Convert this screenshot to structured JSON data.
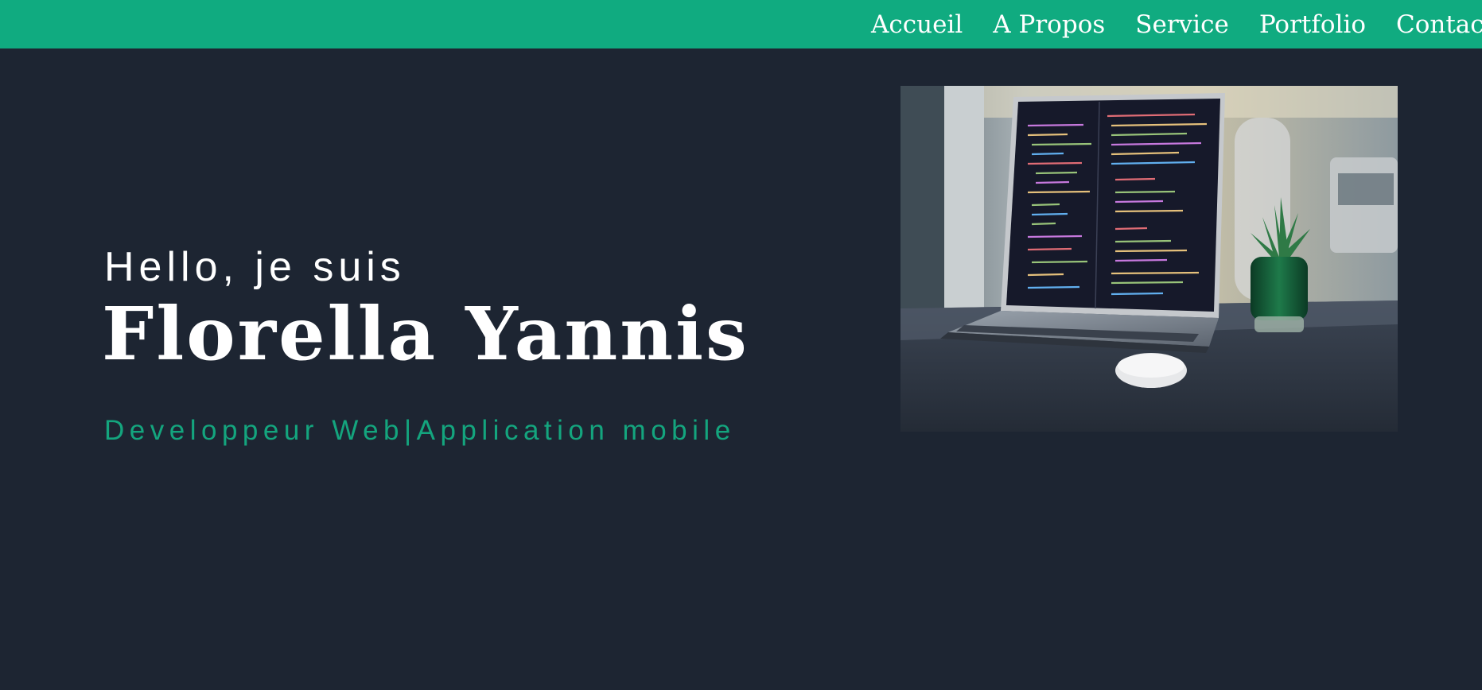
{
  "nav": {
    "items": [
      {
        "label": "Accueil"
      },
      {
        "label": "A Propos"
      },
      {
        "label": "Service"
      },
      {
        "label": "Portfolio"
      },
      {
        "label": "Contact"
      }
    ]
  },
  "hero": {
    "greeting": "Hello, je suis",
    "name": "Florella Yannis",
    "role": "Developpeur Web|Application mobile"
  },
  "colors": {
    "background": "#1d2532",
    "accent": "#10ab80",
    "text": "#ffffff"
  }
}
